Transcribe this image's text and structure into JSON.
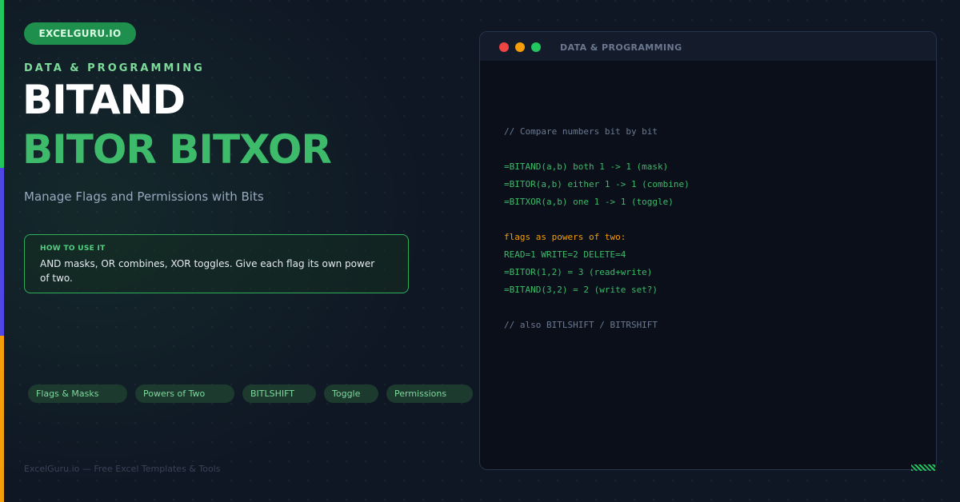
{
  "brand": {
    "label": "EXCELGURU.IO"
  },
  "hero": {
    "category": "DATA & PROGRAMMING",
    "title_line1": "BITAND",
    "title_line2": "BITOR BITXOR",
    "subtitle": "Manage Flags and Permissions with Bits"
  },
  "howto": {
    "label": "HOW TO USE IT",
    "text": "AND masks, OR combines, XOR toggles. Give each flag its own power of two."
  },
  "tags": [
    "Flags & Masks",
    "Powers of Two",
    "BITLSHIFT",
    "Toggle",
    "Permissions"
  ],
  "footer": {
    "text": "ExcelGuru.io — Free Excel Templates & Tools"
  },
  "code_window": {
    "title": "DATA & PROGRAMMING",
    "lines": [
      {
        "text": "// Compare numbers bit by bit",
        "style": "comment"
      },
      {
        "text": "=BITAND(a,b) both 1 -> 1 (mask)",
        "style": "green"
      },
      {
        "text": "=BITOR(a,b) either 1 -> 1 (combine)",
        "style": "green"
      },
      {
        "text": "=BITXOR(a,b) one 1 -> 1 (toggle)",
        "style": "green"
      },
      {
        "text": "flags as powers of two:",
        "style": "orange"
      },
      {
        "text": "READ=1 WRITE=2 DELETE=4",
        "style": "green"
      },
      {
        "text": "=BITOR(1,2) = 3 (read+write)",
        "style": "green"
      },
      {
        "text": "=BITAND(3,2) = 2 (write set?)",
        "style": "green"
      },
      {
        "text": "// also BITLSHIFT / BITRSHIFT",
        "style": "comment"
      }
    ]
  },
  "colors": {
    "accent_green": "#3dba6a",
    "accent_orange": "#f59e0b",
    "accent_indigo": "#4f46e5",
    "background": "#0f1624"
  }
}
